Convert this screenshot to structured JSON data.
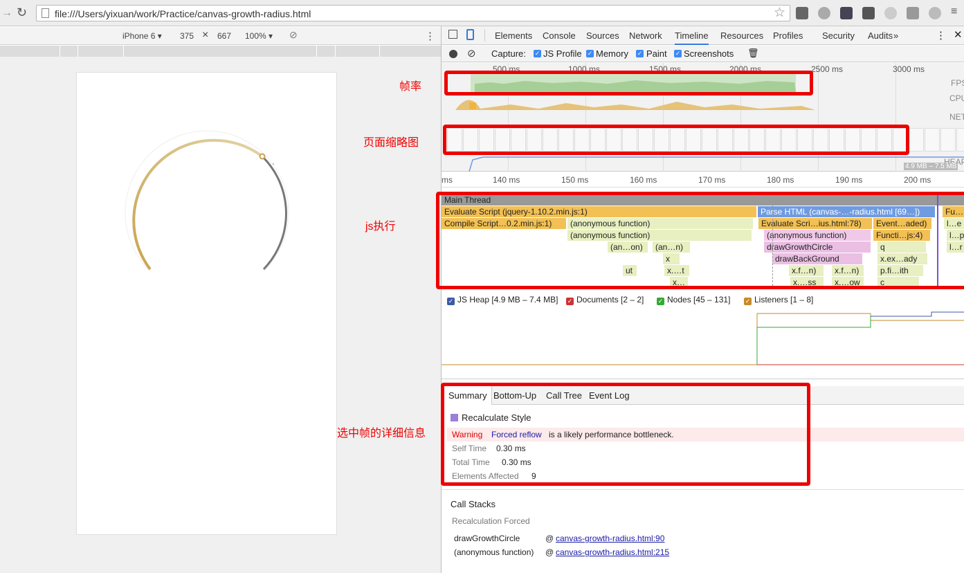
{
  "browser": {
    "url": "file:///Users/yixuan/work/Practice/canvas-growth-radius.html"
  },
  "device": {
    "name": "iPhone 6",
    "width": "375",
    "times": "×",
    "height": "667",
    "zoom": "100%"
  },
  "annotations": {
    "fps": "帧率",
    "filmstrip": "页面缩略图",
    "js": "js执行",
    "detail": "选中帧的详细信息"
  },
  "tabs": [
    "Elements",
    "Console",
    "Sources",
    "Network",
    "Timeline",
    "Resources",
    "Profiles",
    "Security",
    "Audits"
  ],
  "tabs_more": "»",
  "capture": {
    "label": "Capture:",
    "options": [
      "JS Profile",
      "Memory",
      "Paint",
      "Screenshots"
    ]
  },
  "overview": {
    "ticks": [
      "500 ms",
      "1000 ms",
      "1500 ms",
      "2000 ms",
      "2500 ms",
      "3000 ms"
    ],
    "lanes": [
      "FPS",
      "CPU",
      "NET",
      "HEAP"
    ],
    "heap": "4.9 MB – 7.5 MB"
  },
  "ruler": [
    "ms",
    "140 ms",
    "150 ms",
    "160 ms",
    "170 ms",
    "180 ms",
    "190 ms",
    "200 ms"
  ],
  "flame": {
    "main": "Main Thread",
    "r1": [
      "Evaluate Script (jquery-1.10.2.min.js:1)",
      "Parse HTML (canvas-…-radius.html [69…])",
      "Fu…"
    ],
    "r2": [
      "Compile Script…0.2.min.js:1)",
      "(anonymous function)",
      "Evaluate Scri…ius.html:78)",
      "Event…aded)",
      "l…e"
    ],
    "r3": [
      "(anonymous function)",
      "(anonymous function)",
      "Functi…js:4)",
      "l…p"
    ],
    "r4": [
      "(an…on)",
      "(an…n)",
      "drawGrowthCircle",
      "q",
      "l…r"
    ],
    "r5": [
      "x",
      "drawBackGround",
      "x.ex…ady"
    ],
    "r6": [
      "ut",
      "x.…t",
      "x.f…n)",
      "x.f…n)",
      "p.fi…ith"
    ],
    "r7": [
      "x…",
      "x.…ss",
      "x.…ow",
      "c"
    ]
  },
  "counters": [
    "JS Heap [4.9 MB – 7.4 MB]",
    "Documents [2 – 2]",
    "Nodes [45 – 131]",
    "Listeners [1 – 8]"
  ],
  "summary_tabs": [
    "Summary",
    "Bottom-Up",
    "Call Tree",
    "Event Log"
  ],
  "summary": {
    "title": "Recalculate Style",
    "warning_label": "Warning",
    "warning_link": "Forced reflow",
    "warning_text": "is a likely performance bottleneck.",
    "self_label": "Self Time",
    "self": "0.30 ms",
    "total_label": "Total Time",
    "total": "0.30 ms",
    "elements_label": "Elements Affected",
    "elements": "9"
  },
  "callstacks": {
    "title": "Call Stacks",
    "sub": "Recalculation Forced",
    "rows": [
      {
        "fn": "drawGrowthCircle",
        "at": "@",
        "link": "canvas-growth-radius.html:90"
      },
      {
        "fn": "(anonymous function)",
        "at": "@",
        "link": "canvas-growth-radius.html:215"
      }
    ]
  },
  "colors": {
    "accent": "#3879d9",
    "annotation": "#e00000",
    "arc_gold": "#d4b66a",
    "arc_gray": "#777777"
  }
}
